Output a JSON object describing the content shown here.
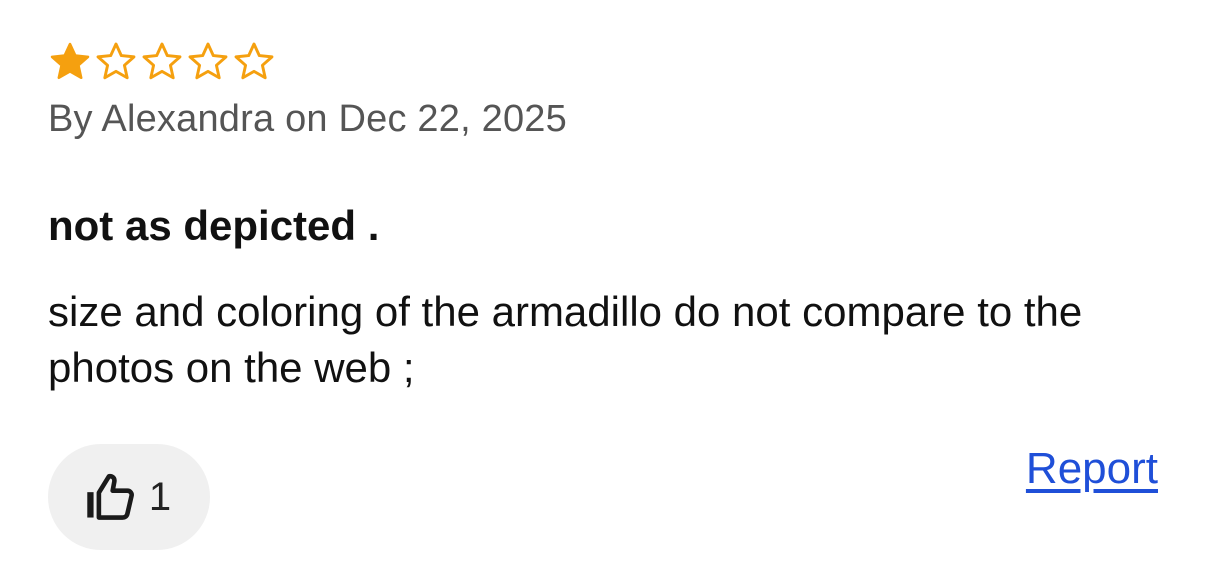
{
  "review": {
    "rating": 1,
    "max_rating": 5,
    "star_color": "#f5a00f",
    "star_icons": [
      "star-filled-icon",
      "star-outline-icon",
      "star-outline-icon",
      "star-outline-icon",
      "star-outline-icon"
    ],
    "byline": "By Alexandra on Dec 22, 2025",
    "title": "not as depicted .",
    "body": "size and coloring of the armadillo do not compare to the photos on the web ;",
    "helpful": {
      "icon": "thumbs-up-icon",
      "count": "1"
    },
    "report_label": "Report",
    "link_color": "#1f4fd8"
  }
}
